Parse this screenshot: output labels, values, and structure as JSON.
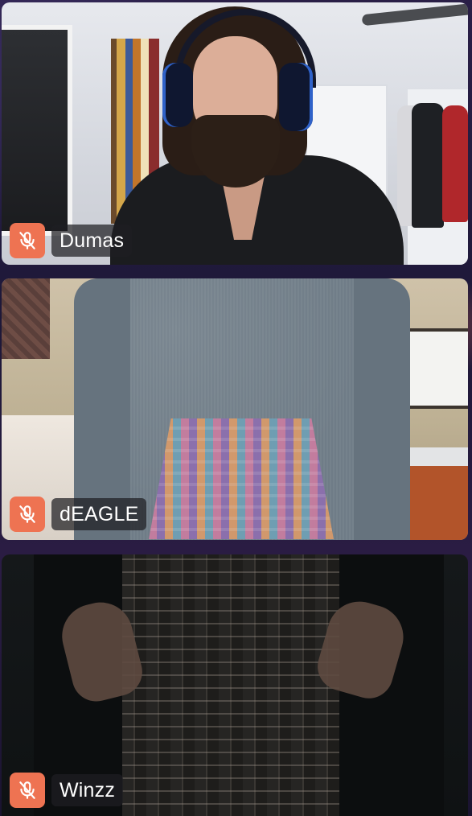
{
  "participants": [
    {
      "name": "Dumas",
      "muted": true,
      "mute_icon": "microphone-muted-icon"
    },
    {
      "name": "dEAGLE",
      "muted": true,
      "mute_icon": "microphone-muted-icon"
    },
    {
      "name": "Winzz",
      "muted": true,
      "mute_icon": "microphone-muted-icon"
    }
  ],
  "colors": {
    "mute_badge": "#ee7352",
    "name_label_bg": "#1e1e22",
    "background": "#221a3e"
  }
}
